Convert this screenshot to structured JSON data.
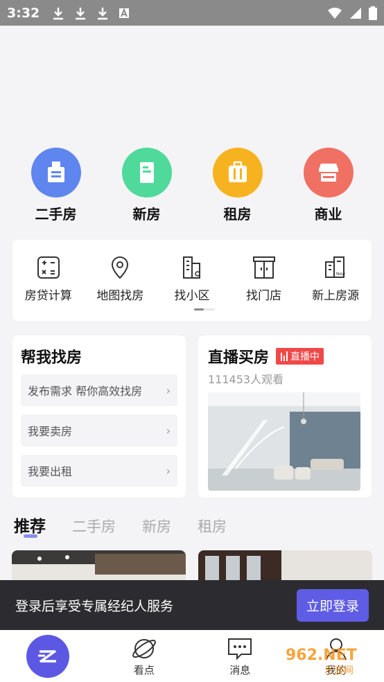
{
  "status_bar": {
    "time": "3:32"
  },
  "main_categories": [
    {
      "label": "二手房",
      "color": "#5f86ee",
      "icon": "building-icon"
    },
    {
      "label": "新房",
      "color": "#4fd99a",
      "icon": "new-building-icon"
    },
    {
      "label": "租房",
      "color": "#f7b31f",
      "icon": "suitcase-icon"
    },
    {
      "label": "商业",
      "color": "#f07063",
      "icon": "shop-icon"
    }
  ],
  "tools": [
    {
      "label": "房贷计算",
      "icon": "calculator-icon"
    },
    {
      "label": "地图找房",
      "icon": "map-pin-icon"
    },
    {
      "label": "找小区",
      "icon": "community-search-icon"
    },
    {
      "label": "找门店",
      "icon": "storefront-icon"
    },
    {
      "label": "新上房源",
      "icon": "new-listing-icon"
    }
  ],
  "help_card": {
    "title": "帮我找房",
    "items": [
      "发布需求 帮你高效找房",
      "我要卖房",
      "我要出租"
    ]
  },
  "live_card": {
    "title": "直播买房",
    "badge": "直播中",
    "viewers": "111453人观看"
  },
  "recommend_tabs": [
    "推荐",
    "二手房",
    "新房",
    "租房"
  ],
  "login_bar": {
    "text": "登录后享受专属经纪人服务",
    "button": "立即登录"
  },
  "bottom_nav": [
    {
      "label": "",
      "icon": "home-logo-icon"
    },
    {
      "label": "看点",
      "icon": "planet-icon"
    },
    {
      "label": "消息",
      "icon": "message-icon"
    },
    {
      "label": "我的",
      "icon": "user-icon"
    }
  ],
  "watermark": {
    "text1": "962.NET",
    "text2": "乐游网"
  },
  "colors": {
    "accent": "#5c58e4",
    "live_red": "#f04848"
  }
}
